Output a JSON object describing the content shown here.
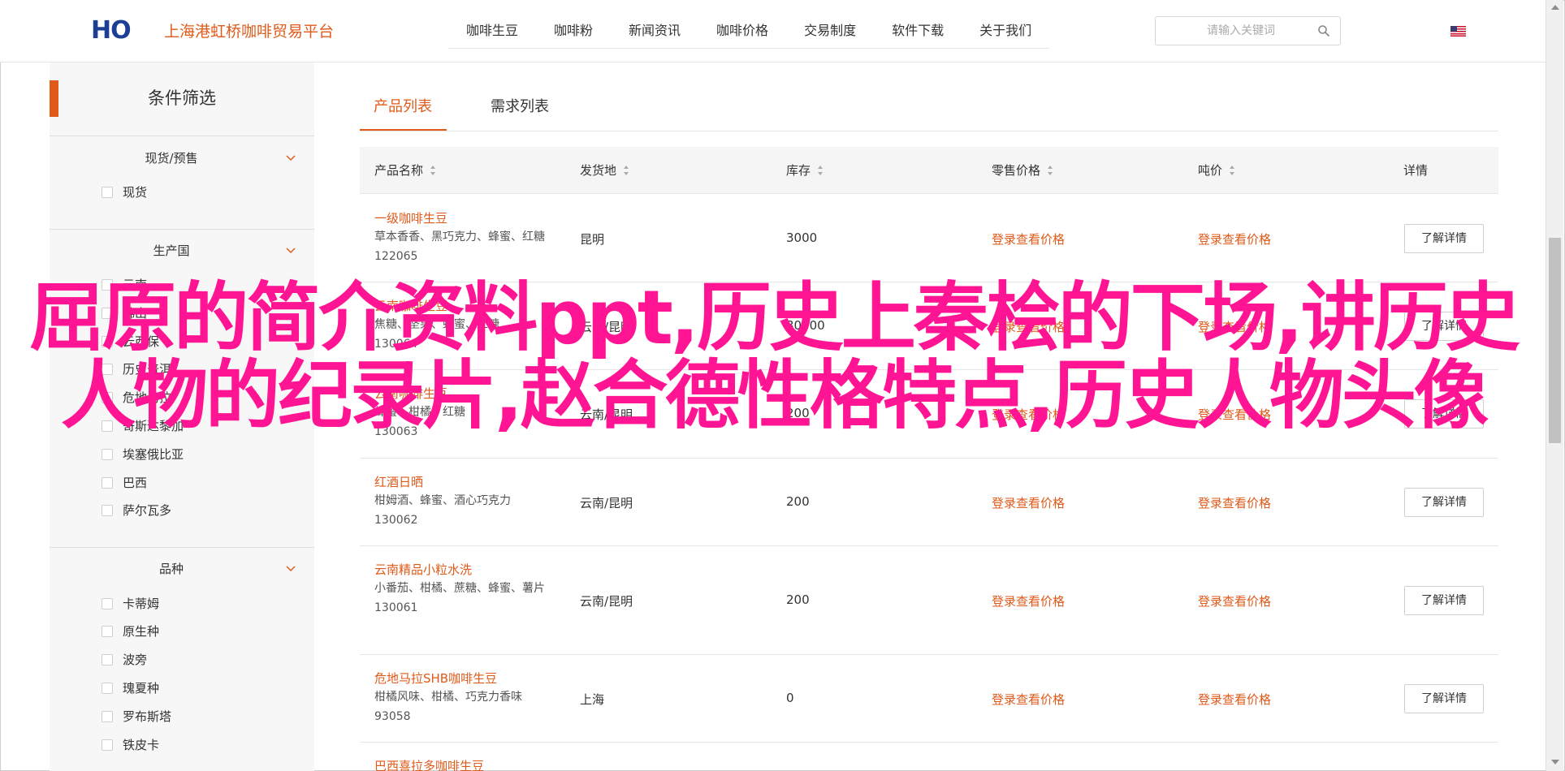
{
  "header": {
    "logo_text": "HO",
    "site_name": "上海港虹桥咖啡贸易平台",
    "nav": [
      "咖啡生豆",
      "咖啡粉",
      "新闻资讯",
      "咖啡价格",
      "交易制度",
      "软件下载",
      "关于我们"
    ],
    "search_placeholder": "请输入关键词"
  },
  "sidebar": {
    "title": "条件筛选",
    "groups": [
      {
        "label": "现货/预售",
        "options": [
          "现货"
        ]
      },
      {
        "label": "生产国",
        "options": [
          "云南",
          "佛山",
          "云西保",
          "历史普洱",
          "危地马拉",
          "哥斯达黎加",
          "埃塞俄比亚",
          "巴西",
          "萨尔瓦多"
        ]
      },
      {
        "label": "品种",
        "options": [
          "卡蒂姆",
          "原生种",
          "波旁",
          "瑰夏种",
          "罗布斯塔",
          "铁皮卡"
        ]
      }
    ]
  },
  "tabs": {
    "active": "产品列表",
    "inactive": "需求列表"
  },
  "table": {
    "headers": [
      "产品名称",
      "发货地",
      "库存",
      "零售价格",
      "吨价",
      "详情"
    ],
    "rows": [
      {
        "name": "一级咖啡生豆",
        "desc": "草本香香、黑巧克力、蜂蜜、红糖",
        "code": "122065",
        "origin": "昆明",
        "stock": "3000",
        "retail": "登录查看价格",
        "ton": "登录查看价格",
        "detail": "了解详情"
      },
      {
        "name": "云南咖啡生豆",
        "desc": "焦糖、坚果、蜂蜜、红糖",
        "code": "130064",
        "origin": "云南/昆明",
        "stock": "30000",
        "retail": "登录查看价格",
        "ton": "登录查看价格",
        "detail": "了解详情"
      },
      {
        "name": "云南咖啡生豆",
        "desc": "蜂蜜、柑橘、红糖",
        "code": "130063",
        "origin": "云南/昆明",
        "stock": "200",
        "retail": "登录查看价格",
        "ton": "登录查看价格",
        "detail": "了解详情"
      },
      {
        "name": "红酒日晒",
        "desc": "柑姆酒、蜂蜜、酒心巧克力",
        "code": "130062",
        "origin": "云南/昆明",
        "stock": "200",
        "retail": "登录查看价格",
        "ton": "登录查看价格",
        "detail": "了解详情"
      },
      {
        "name": "云南精品小粒水洗",
        "desc": "小番茄、柑橘、蔗糖、蜂蜜、薯片",
        "code": "130061",
        "origin": "云南/昆明",
        "stock": "200",
        "retail": "登录查看价格",
        "ton": "登录查看价格",
        "detail": "了解详情"
      },
      {
        "name": "危地马拉SHB咖啡生豆",
        "desc": "柑橘风味、柑橘、巧克力香味",
        "code": "93058",
        "origin": "上海",
        "stock": "0",
        "retail": "登录查看价格",
        "ton": "登录查看价格",
        "detail": "了解详情"
      },
      {
        "name": "巴西喜拉多咖啡生豆",
        "desc": "",
        "code": "",
        "origin": "",
        "stock": "",
        "retail": "",
        "ton": "",
        "detail": ""
      }
    ]
  },
  "overlay": {
    "text": "屈原的简介资料ppt,历史上秦桧的下场,讲历史人物的纪录片,赵合德性格特点,历史人物头像"
  },
  "colors": {
    "accent": "#e05a1a",
    "overlay": "#ff1493",
    "logo": "#1c3f94"
  }
}
